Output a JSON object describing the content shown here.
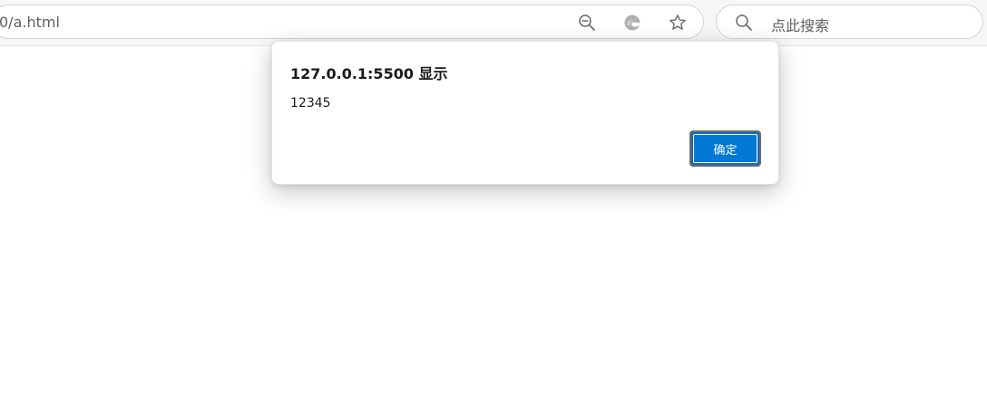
{
  "browser": {
    "address": {
      "url_visible": "0/a.html"
    },
    "address_icons": [
      "zoom-out-icon",
      "edge-icon",
      "favorite-star-icon"
    ],
    "search": {
      "placeholder": "点此搜索",
      "icon": "search-icon"
    }
  },
  "dialog": {
    "title": "127.0.0.1:5500 显示",
    "message": "12345",
    "ok_label": "确定"
  },
  "colors": {
    "accent": "#0078d4",
    "toolbar_bg": "#f7f7f7",
    "page_bg": "#ffffff"
  }
}
